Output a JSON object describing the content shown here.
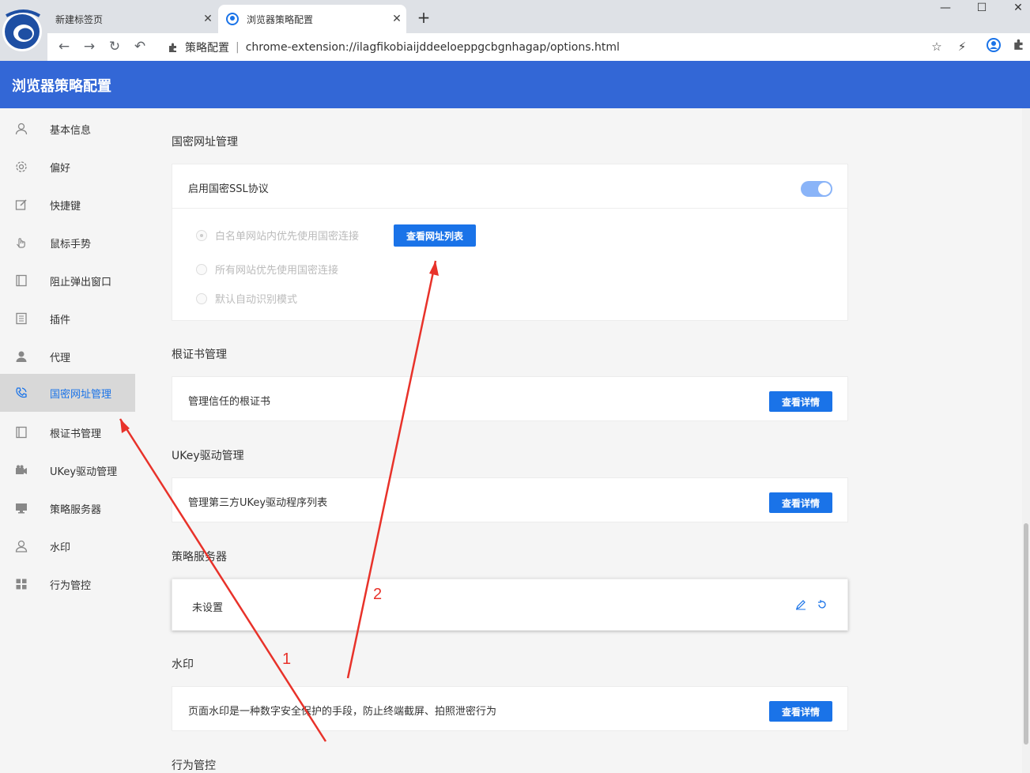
{
  "browser": {
    "tabs": [
      {
        "title": "新建标签页",
        "close": "✕",
        "active": false
      },
      {
        "title": "浏览器策略配置",
        "close": "✕",
        "active": true
      }
    ],
    "new_tab": "+",
    "window_controls": {
      "minimize": "—",
      "maximize": "☐",
      "close": "✕"
    },
    "nav": {
      "back": "←",
      "forward": "→",
      "reload": "↻",
      "undo": "↶"
    },
    "omnibox": {
      "ext_name": "策略配置",
      "separator": "|",
      "url": "chrome-extension://ilagfikobiaijddeeloeppgcbgnhagap/options.html"
    },
    "right_icons": [
      "star-icon",
      "lightning-icon",
      "profile-icon",
      "extension-icon"
    ]
  },
  "header": {
    "title": "浏览器策略配置"
  },
  "sidebar": {
    "items": [
      {
        "label": "基本信息",
        "icon": "user-icon",
        "active": false
      },
      {
        "label": "偏好",
        "icon": "gear-icon",
        "active": false
      },
      {
        "label": "快捷键",
        "icon": "edit-icon",
        "active": false
      },
      {
        "label": "鼠标手势",
        "icon": "hand-icon",
        "active": false
      },
      {
        "label": "阻止弹出窗口",
        "icon": "window-icon",
        "active": false
      },
      {
        "label": "插件",
        "icon": "list-icon",
        "active": false
      },
      {
        "label": "代理",
        "icon": "person-icon",
        "active": false
      },
      {
        "label": "国密网址管理",
        "icon": "phone-icon",
        "active": true
      },
      {
        "label": "根证书管理",
        "icon": "cert-icon",
        "active": false
      },
      {
        "label": "UKey驱动管理",
        "icon": "camera-icon",
        "active": false
      },
      {
        "label": "策略服务器",
        "icon": "monitor-icon",
        "active": false
      },
      {
        "label": "水印",
        "icon": "user-outline-icon",
        "active": false
      },
      {
        "label": "行为管控",
        "icon": "grid-icon",
        "active": false
      }
    ]
  },
  "main": {
    "gm_section": {
      "title": "国密网址管理",
      "enable_label": "启用国密SSL协议",
      "enabled": true,
      "options": [
        {
          "label": "白名单网站内优先使用国密连接",
          "checked": true
        },
        {
          "label": "所有网站优先使用国密连接",
          "checked": false
        },
        {
          "label": "默认自动识别模式",
          "checked": false
        }
      ],
      "list_button": "查看网址列表"
    },
    "cert_section": {
      "title": "根证书管理",
      "label": "管理信任的根证书",
      "button": "查看详情"
    },
    "ukey_section": {
      "title": "UKey驱动管理",
      "label": "管理第三方UKey驱动程序列表",
      "button": "查看详情"
    },
    "server_section": {
      "title": "策略服务器",
      "label": "未设置"
    },
    "watermark_section": {
      "title": "水印",
      "label": "页面水印是一种数字安全保护的手段，防止终端截屏、拍照泄密行为",
      "button": "查看详情"
    },
    "behavior_section": {
      "title": "行为管控"
    }
  },
  "annotations": {
    "label1": "1",
    "label2": "2",
    "color": "#e8322a"
  }
}
